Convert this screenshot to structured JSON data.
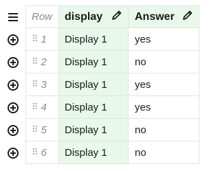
{
  "header": {
    "row_label": "Row",
    "columns": [
      {
        "label": "display",
        "icon": "pencil-icon"
      },
      {
        "label": "Answer",
        "icon": "pencil-icon"
      }
    ],
    "menu_icon": "hamburger-menu-icon"
  },
  "rows": [
    {
      "num": "1",
      "display": "Display 1",
      "answer": "yes"
    },
    {
      "num": "2",
      "display": "Display 1",
      "answer": "no"
    },
    {
      "num": "3",
      "display": "Display 1",
      "answer": "yes"
    },
    {
      "num": "4",
      "display": "Display 1",
      "answer": "yes"
    },
    {
      "num": "5",
      "display": "Display 1",
      "answer": "no"
    },
    {
      "num": "6",
      "display": "Display 1",
      "answer": "no"
    }
  ],
  "row_icons": {
    "add": "add-circle-icon",
    "drag": "drag-handle-icon"
  },
  "colors": {
    "header_highlight": "#e8f8ea",
    "border": "#e3e3e3",
    "muted_text": "#8a8a8a"
  }
}
